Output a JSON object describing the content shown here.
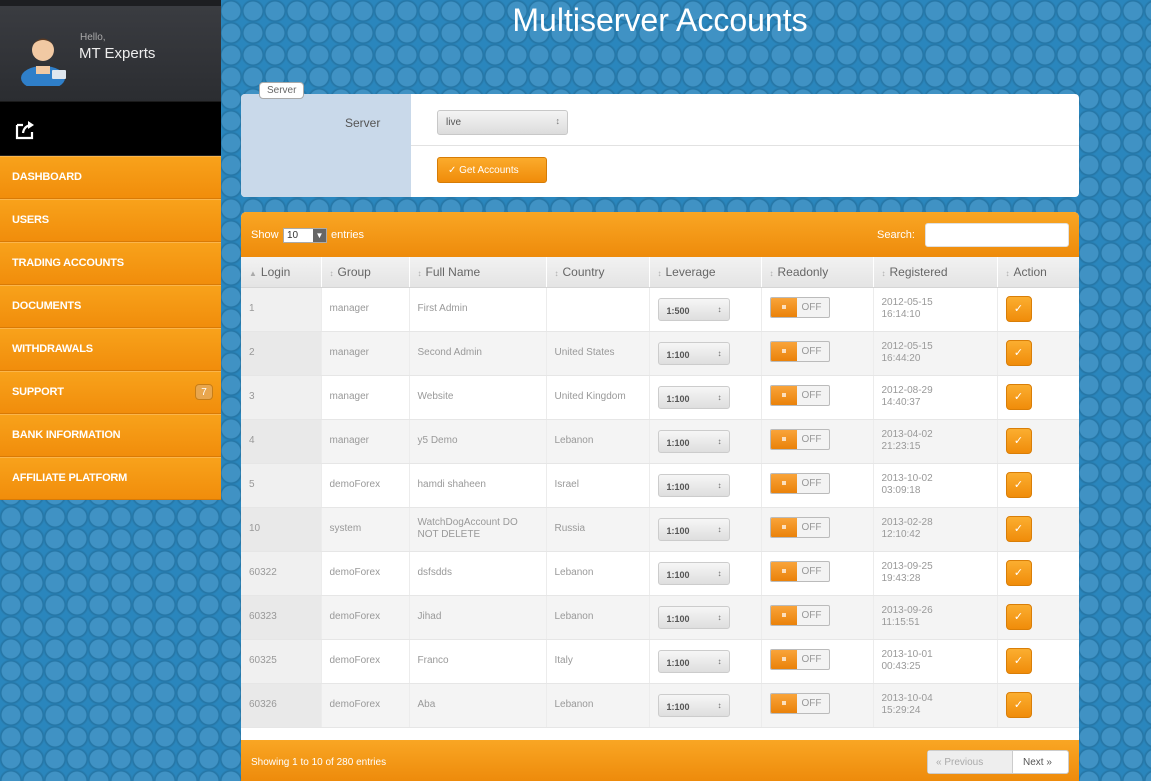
{
  "sidebar": {
    "greeting": "Hello,",
    "user_name": "MT Experts",
    "menu": [
      {
        "label": "Dashboard",
        "badge": ""
      },
      {
        "label": "Users",
        "badge": ""
      },
      {
        "label": "Trading Accounts",
        "badge": ""
      },
      {
        "label": "Documents",
        "badge": ""
      },
      {
        "label": "Withdrawals",
        "badge": ""
      },
      {
        "label": "Support",
        "badge": "7"
      },
      {
        "label": "Bank Information",
        "badge": ""
      },
      {
        "label": "Affiliate Platform",
        "badge": ""
      }
    ]
  },
  "page": {
    "title": "Multiserver Accounts"
  },
  "server_panel": {
    "legend": "Server",
    "label": "Server",
    "selected": "live",
    "get_button": "✓ Get Accounts"
  },
  "table": {
    "show_label": "Show",
    "page_length": "10",
    "entries_label": "entries",
    "search_label": "Search:",
    "columns": [
      "Login",
      "Group",
      "Full Name",
      "Country",
      "Leverage",
      "Readonly",
      "Registered",
      "Action"
    ],
    "rows": [
      {
        "login": "1",
        "group": "manager",
        "name": "First Admin",
        "country": "",
        "leverage": "1:500",
        "readonly": "OFF",
        "registered_date": "2012-05-15",
        "registered_time": "16:14:10"
      },
      {
        "login": "2",
        "group": "manager",
        "name": "Second Admin",
        "country": "United States",
        "leverage": "1:100",
        "readonly": "OFF",
        "registered_date": "2012-05-15",
        "registered_time": "16:44:20"
      },
      {
        "login": "3",
        "group": "manager",
        "name": "Website",
        "country": "United Kingdom",
        "leverage": "1:100",
        "readonly": "OFF",
        "registered_date": "2012-08-29",
        "registered_time": "14:40:37"
      },
      {
        "login": "4",
        "group": "manager",
        "name": "y5 Demo",
        "country": "Lebanon",
        "leverage": "1:100",
        "readonly": "OFF",
        "registered_date": "2013-04-02",
        "registered_time": "21:23:15"
      },
      {
        "login": "5",
        "group": "demoForex",
        "name": "hamdi shaheen",
        "country": "Israel",
        "leverage": "1:100",
        "readonly": "OFF",
        "registered_date": "2013-10-02",
        "registered_time": "03:09:18"
      },
      {
        "login": "10",
        "group": "system",
        "name": "WatchDogAccount DO NOT DELETE",
        "country": "Russia",
        "leverage": "1:100",
        "readonly": "OFF",
        "registered_date": "2013-02-28",
        "registered_time": "12:10:42"
      },
      {
        "login": "60322",
        "group": "demoForex",
        "name": "dsfsdds",
        "country": "Lebanon",
        "leverage": "1:100",
        "readonly": "OFF",
        "registered_date": "2013-09-25",
        "registered_time": "19:43:28"
      },
      {
        "login": "60323",
        "group": "demoForex",
        "name": "Jihad",
        "country": "Lebanon",
        "leverage": "1:100",
        "readonly": "OFF",
        "registered_date": "2013-09-26",
        "registered_time": "11:15:51"
      },
      {
        "login": "60325",
        "group": "demoForex",
        "name": "Franco",
        "country": "Italy",
        "leverage": "1:100",
        "readonly": "OFF",
        "registered_date": "2013-10-01",
        "registered_time": "00:43:25"
      },
      {
        "login": "60326",
        "group": "demoForex",
        "name": "Aba",
        "country": "Lebanon",
        "leverage": "1:100",
        "readonly": "OFF",
        "registered_date": "2013-10-04",
        "registered_time": "15:29:24"
      }
    ],
    "info": "Showing 1 to 10 of 280 entries",
    "prev_label": "« Previous",
    "next_label": "Next »"
  },
  "colors": {
    "background": "#2a86bd",
    "accent": "#f39410",
    "sidebar_dark": "#2b2d31"
  }
}
